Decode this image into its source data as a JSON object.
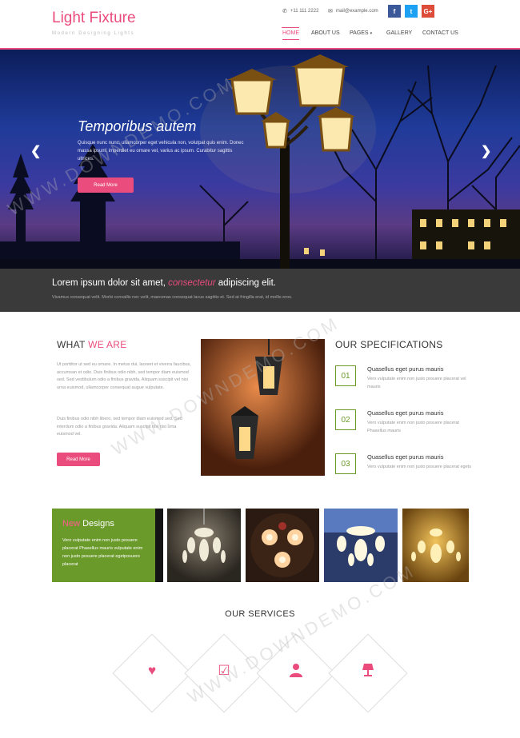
{
  "header": {
    "logo_title": "Light Fixture",
    "logo_subtitle": "Modern Designing Lights",
    "phone": "+11 111 2222",
    "email": "mail@example.com",
    "social": [
      "f",
      "t",
      "G+"
    ],
    "nav": [
      {
        "label": "HOME",
        "active": true
      },
      {
        "label": "ABOUT US",
        "active": false
      },
      {
        "label": "PAGES",
        "active": false
      },
      {
        "label": "GALLERY",
        "active": false
      },
      {
        "label": "CONTACT US",
        "active": false
      }
    ]
  },
  "hero": {
    "title": "Temporibus autem",
    "text": "Quisque nunc nunc, ullamcorper eget vehicula non, volutpat quis enim. Donec massa ipsum, imperdiet eu ornare vel, varius ac ipsum. Curabitur sagittis ultrices.",
    "button": "Read More"
  },
  "bar": {
    "title_start": "Lorem ipsum dolor sit amet, ",
    "title_highlight": "consectetur",
    "title_end": " adipiscing elit.",
    "text": "Vivamus consequat velit. Morbi convallis nec velit, maecenas consequat lacus sagittis et. Sed at fringilla erat, id mollis eros."
  },
  "about": {
    "title_start": "WHAT ",
    "title_highlight": "WE ARE",
    "para1": "Ut porttitor ut sed eu ornare. In metus dui, laoreet et viverra faucibus, accumsan et odio. Duis finibus odio nibh, sed tempor diam euismod sed. Sed vestibulum odio a finibus gravida. Aliquam suscipit vel nisi urna euismod, ullamcorper consequat augue vulputate.",
    "para2": "Duis finibus odio nibh libero, sed tempor diam euismod sed. Sed interdum odio a finibus gravida. Aliquam suscipit nisl nisi urna euismod vel.",
    "button": "Read More"
  },
  "specs": {
    "title": "OUR SPECIFICATIONS",
    "items": [
      {
        "num": "01",
        "title": "Quasellus eget purus mauris",
        "text": "Vero vulputate enim non justo posuere placerat vel mauris"
      },
      {
        "num": "02",
        "title": "Quasellus eget purus mauris",
        "text": "Vero vulputate enim non justo posuere placerat Phasellus mauris"
      },
      {
        "num": "03",
        "title": "Quasellus eget purus mauris",
        "text": "Vero vulputate enim non justo posuere placerat egets"
      }
    ]
  },
  "new_designs": {
    "title_highlight": "New",
    "title_rest": " Designs",
    "text": "Vero vulputate enim non justo posuere placerat Phasellus mauris vulputate enim non justo posuere placerat egetposuere placerat"
  },
  "services": {
    "title": "OUR SERVICES"
  },
  "watermark": "WWW.DOWNDEMO.COM",
  "colors": {
    "accent": "#ea4c7d",
    "green": "#6a9a2a",
    "bar": "#3a3a3a"
  }
}
